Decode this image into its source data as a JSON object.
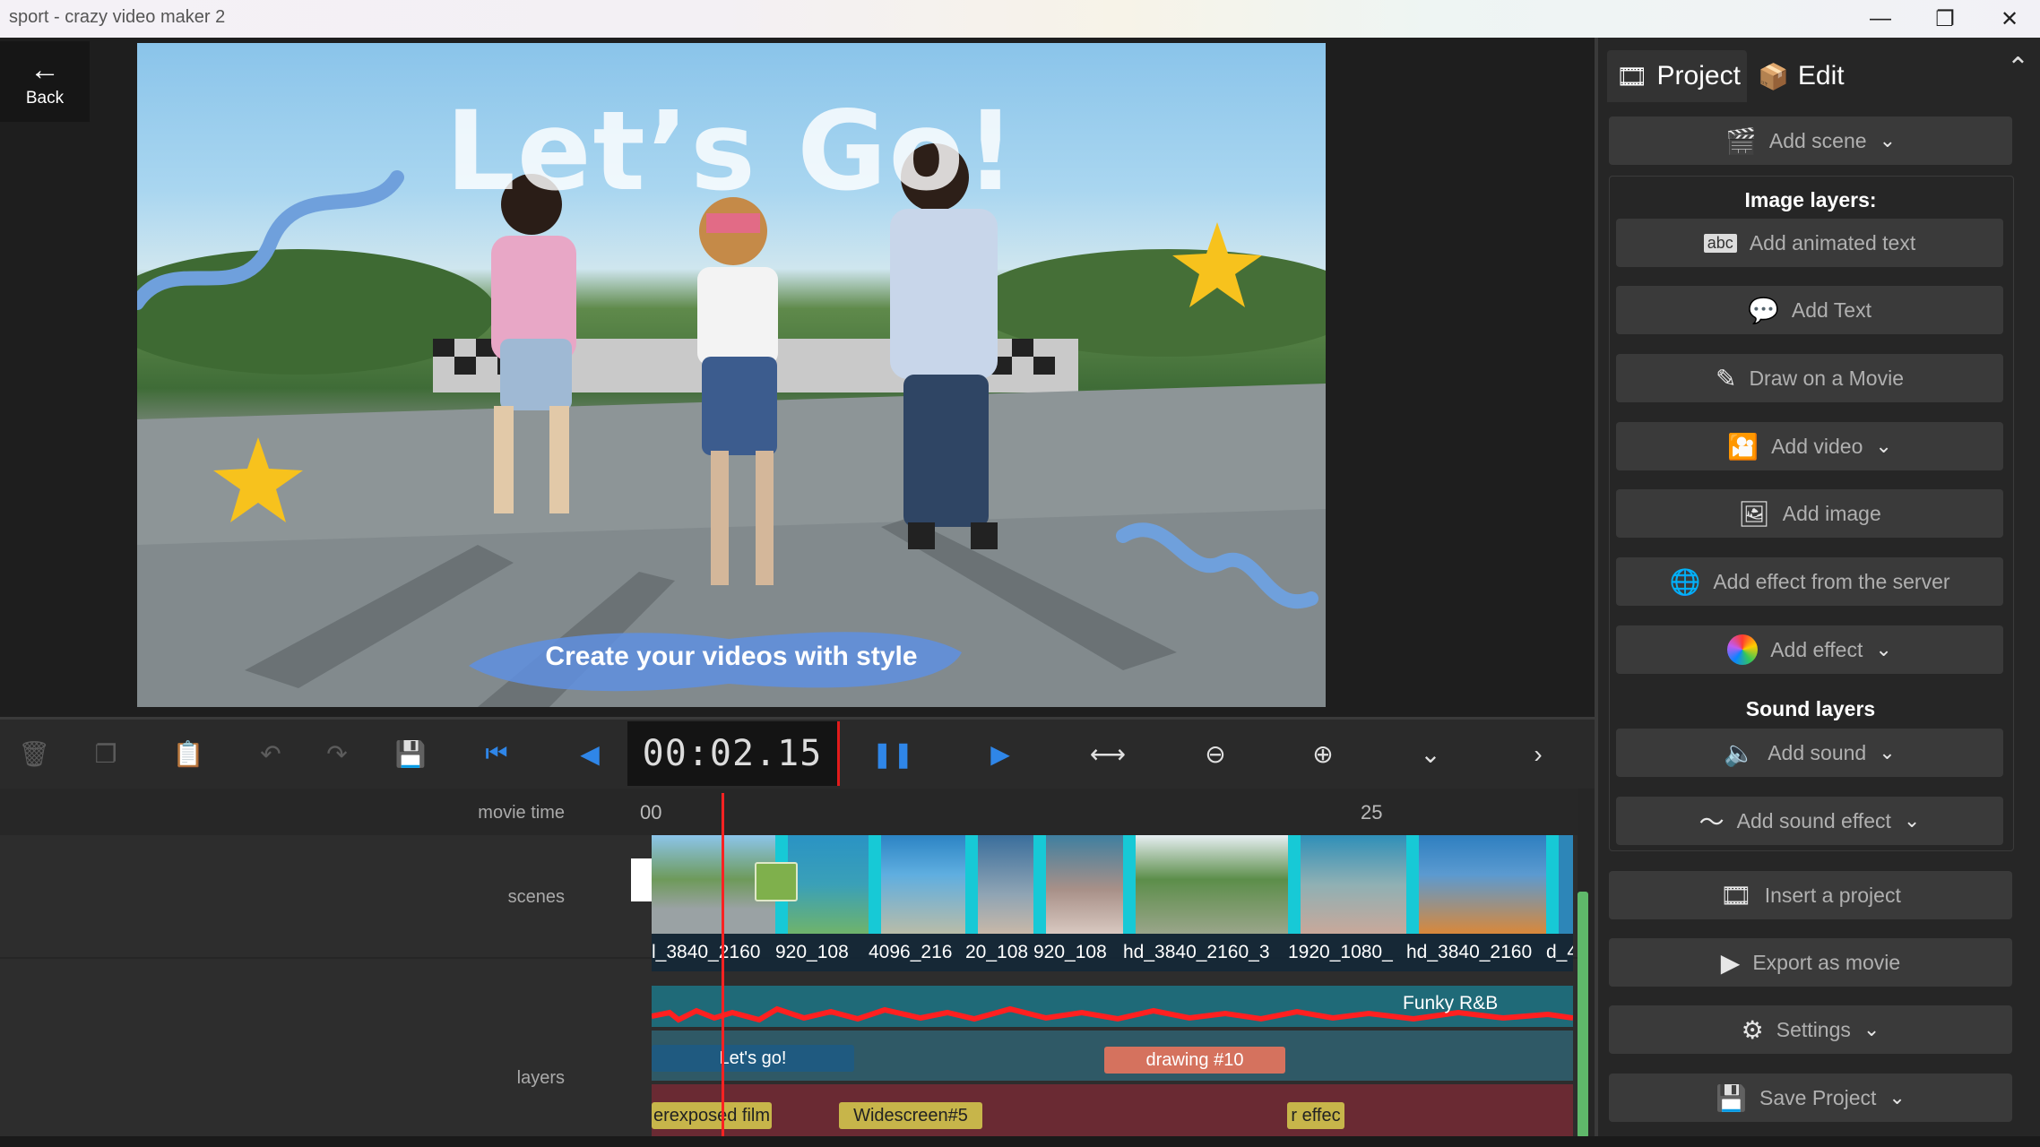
{
  "window": {
    "title": "sport - crazy video maker 2"
  },
  "back": {
    "label": "Back"
  },
  "preview": {
    "headline": "Let’s Go!",
    "subtitle": "Create your videos with style"
  },
  "toolbar": {
    "timecode": "00:02.15"
  },
  "timeline": {
    "ruler_label": "movie time",
    "ruler_marks": [
      "00",
      "25"
    ],
    "scenes_label": "scenes",
    "layers_label": "layers",
    "scenes": [
      "l_3840_2160",
      "920_108",
      "4096_216",
      "20_108",
      "920_108",
      "hd_3840_2160_3",
      "1920_1080_",
      "hd_3840_2160",
      "d_4"
    ],
    "audio_track": "Funky R&B",
    "layer_clips": [
      "Let's go!",
      "drawing #10"
    ],
    "effect_clips": [
      "erexposed film",
      "Widescreen#5",
      "r effec"
    ]
  },
  "panel": {
    "tabs": [
      "Project",
      "Edit"
    ],
    "add_scene": "Add scene",
    "image_layers_title": "Image layers:",
    "image_buttons": [
      "Add animated text",
      "Add Text",
      "Draw on a Movie",
      "Add video",
      "Add image",
      "Add effect from the server",
      "Add effect"
    ],
    "sound_layers_title": "Sound layers",
    "sound_buttons": [
      "Add sound",
      "Add sound effect"
    ],
    "project_buttons": [
      "Insert a project",
      "Export as movie",
      "Settings",
      "Save Project"
    ]
  }
}
